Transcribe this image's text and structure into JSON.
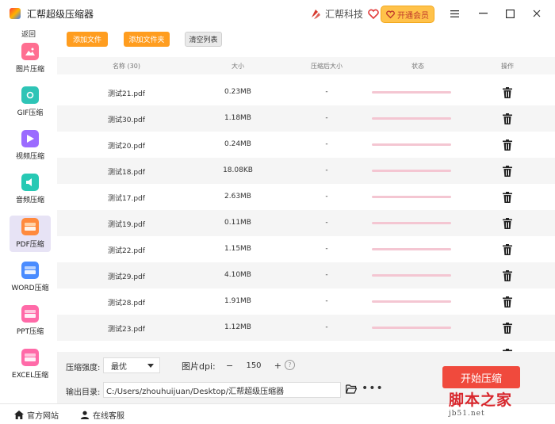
{
  "app": {
    "title": "汇帮超级压缩器",
    "brand": "汇帮科技",
    "vip_label": "开通会员"
  },
  "sidebar": {
    "back_label": "返回",
    "items": [
      {
        "label": "图片压缩",
        "color": "#ff6f91"
      },
      {
        "label": "GIF压缩",
        "color": "#2ec4b6"
      },
      {
        "label": "视频压缩",
        "color": "#9b6bff"
      },
      {
        "label": "音频压缩",
        "color": "#27c9b4"
      },
      {
        "label": "PDF压缩",
        "color": "#ff8a3d",
        "active": true
      },
      {
        "label": "WORD压缩",
        "color": "#4a8cff"
      },
      {
        "label": "PPT压缩",
        "color": "#ff6aa8"
      },
      {
        "label": "EXCEL压缩",
        "color": "#ff6aa8"
      }
    ]
  },
  "toolbar": {
    "add_file": "添加文件",
    "add_folder": "添加文件夹",
    "clear_list": "清空列表"
  },
  "table": {
    "headers": {
      "name": "名称 (30)",
      "size": "大小",
      "compressed": "压缩后大小",
      "status": "状态",
      "action": "操作"
    },
    "rows": [
      {
        "name": "测试21.pdf",
        "size": "0.23MB",
        "compressed": "-"
      },
      {
        "name": "测试30.pdf",
        "size": "1.18MB",
        "compressed": "-"
      },
      {
        "name": "测试20.pdf",
        "size": "0.24MB",
        "compressed": "-"
      },
      {
        "name": "测试18.pdf",
        "size": "18.08KB",
        "compressed": "-"
      },
      {
        "name": "测试17.pdf",
        "size": "2.63MB",
        "compressed": "-"
      },
      {
        "name": "测试19.pdf",
        "size": "0.11MB",
        "compressed": "-"
      },
      {
        "name": "测试22.pdf",
        "size": "1.15MB",
        "compressed": "-"
      },
      {
        "name": "测试29.pdf",
        "size": "4.10MB",
        "compressed": "-"
      },
      {
        "name": "测试28.pdf",
        "size": "1.91MB",
        "compressed": "-"
      },
      {
        "name": "测试23.pdf",
        "size": "1.12MB",
        "compressed": "-"
      }
    ]
  },
  "settings": {
    "strength_label": "压缩强度:",
    "strength_value": "最优",
    "dpi_label": "图片dpi:",
    "dpi_value": "150",
    "minus": "−",
    "plus": "+",
    "help": "?",
    "output_label": "输出目录:",
    "output_path": "C:/Users/zhouhuijuan/Desktop/汇帮超级压缩器",
    "more": "•••",
    "start_label": "开始压缩"
  },
  "footer": {
    "website": "官方网站",
    "support": "在线客服"
  },
  "watermark": {
    "main": "脚本之家",
    "sub": "jb51.net"
  },
  "colors": {
    "accent_orange": "#ff9d1f",
    "start_red": "#f04a3d",
    "progress_pink": "#f4c6d2",
    "active_nav": "#e7e3f5"
  }
}
